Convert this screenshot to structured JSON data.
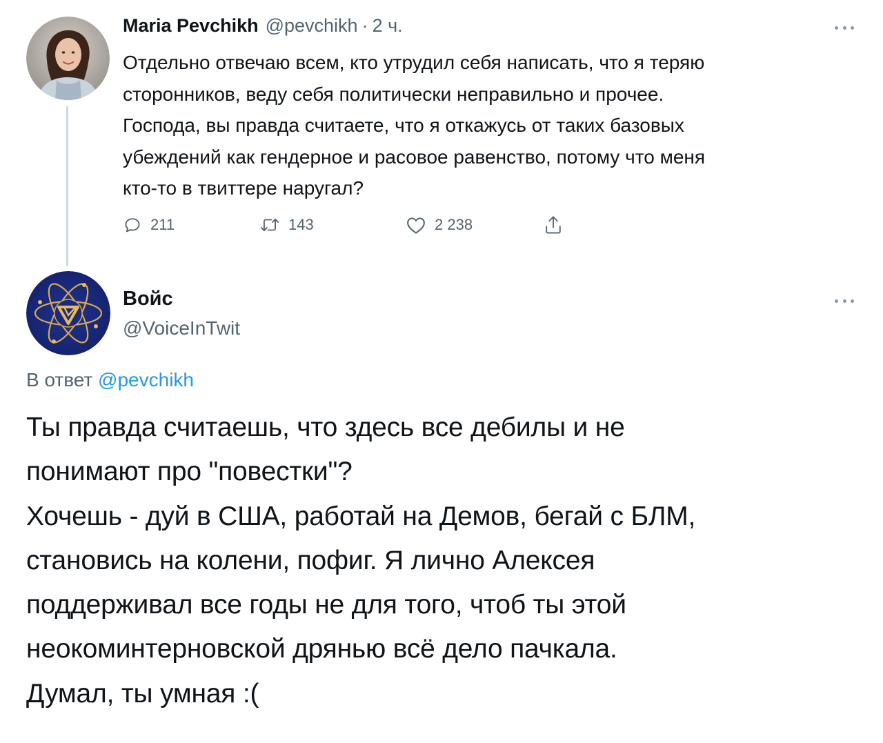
{
  "parent_tweet": {
    "author_name": "Maria Pevchikh",
    "author_handle": "@pevchikh",
    "separator": "·",
    "timestamp": "2 ч.",
    "text_lines": [
      "Отдельно отвечаю всем, кто утрудил себя написать, что я теряю",
      "сторонников, веду себя политически неправильно и прочее.",
      "Господа, вы правда считаете, что я откажусь от таких базовых",
      "убеждений как гендерное и расовое равенство, потому что меня",
      "кто-то в твиттере наругал?"
    ],
    "stats": {
      "replies": "211",
      "retweets": "143",
      "likes": "2 238"
    }
  },
  "reply_tweet": {
    "author_name": "Войс",
    "author_handle": "@VoiceInTwit",
    "replying_to_prefix": "В ответ",
    "replying_to_handle": "@pevchikh",
    "text_lines": [
      "Ты правда считаешь, что здесь все дебилы и не",
      "понимают про \"повестки\"?",
      "Хочешь - дуй в США, работай на Демов, бегай с БЛМ,",
      "становись на колени, пофиг. Я лично Алексея",
      "поддерживал все годы не для того, чтоб ты этой",
      "неокоминтерновской дрянью всё дело пачкала.",
      "Думал, ты умная :("
    ]
  },
  "icons": {
    "more": "more-horizontal-icon",
    "reply": "reply-bubble-icon",
    "retweet": "retweet-icon",
    "like": "heart-icon",
    "share": "share-icon"
  },
  "colors": {
    "text_primary": "#0f1419",
    "text_secondary": "#536471",
    "link": "#1d9bf0",
    "thread_line": "#cfd9de"
  }
}
